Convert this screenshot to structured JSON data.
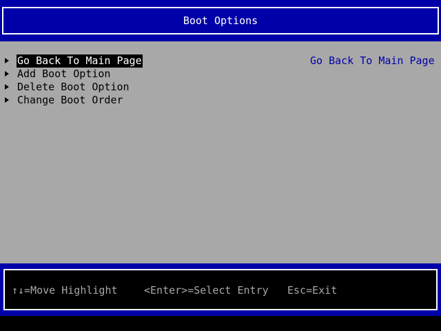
{
  "header": {
    "title": "Boot Options"
  },
  "menu": {
    "items": [
      {
        "label": "Go Back To Main Page",
        "selected": true
      },
      {
        "label": "Add Boot Option",
        "selected": false
      },
      {
        "label": "Delete Boot Option",
        "selected": false
      },
      {
        "label": "Change Boot Order",
        "selected": false
      }
    ]
  },
  "help": {
    "text": "Go Back To Main Page"
  },
  "footer": {
    "move_hint": "↑↓=Move Highlight",
    "select_hint": "<Enter>=Select Entry",
    "exit_hint": "Esc=Exit"
  },
  "colors": {
    "bios_blue": "#0000a8",
    "panel_gray": "#a8a8a8",
    "text_black": "#000000",
    "text_white": "#ffffff"
  }
}
